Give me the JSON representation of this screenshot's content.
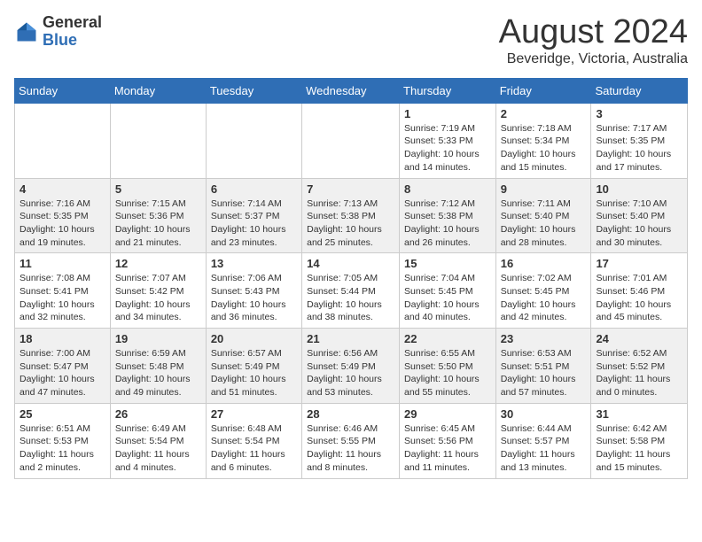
{
  "header": {
    "logo_general": "General",
    "logo_blue": "Blue",
    "month": "August 2024",
    "location": "Beveridge, Victoria, Australia"
  },
  "days_of_week": [
    "Sunday",
    "Monday",
    "Tuesday",
    "Wednesday",
    "Thursday",
    "Friday",
    "Saturday"
  ],
  "weeks": [
    [
      {
        "day": "",
        "text": ""
      },
      {
        "day": "",
        "text": ""
      },
      {
        "day": "",
        "text": ""
      },
      {
        "day": "",
        "text": ""
      },
      {
        "day": "1",
        "text": "Sunrise: 7:19 AM\nSunset: 5:33 PM\nDaylight: 10 hours and 14 minutes."
      },
      {
        "day": "2",
        "text": "Sunrise: 7:18 AM\nSunset: 5:34 PM\nDaylight: 10 hours and 15 minutes."
      },
      {
        "day": "3",
        "text": "Sunrise: 7:17 AM\nSunset: 5:35 PM\nDaylight: 10 hours and 17 minutes."
      }
    ],
    [
      {
        "day": "4",
        "text": "Sunrise: 7:16 AM\nSunset: 5:35 PM\nDaylight: 10 hours and 19 minutes."
      },
      {
        "day": "5",
        "text": "Sunrise: 7:15 AM\nSunset: 5:36 PM\nDaylight: 10 hours and 21 minutes."
      },
      {
        "day": "6",
        "text": "Sunrise: 7:14 AM\nSunset: 5:37 PM\nDaylight: 10 hours and 23 minutes."
      },
      {
        "day": "7",
        "text": "Sunrise: 7:13 AM\nSunset: 5:38 PM\nDaylight: 10 hours and 25 minutes."
      },
      {
        "day": "8",
        "text": "Sunrise: 7:12 AM\nSunset: 5:38 PM\nDaylight: 10 hours and 26 minutes."
      },
      {
        "day": "9",
        "text": "Sunrise: 7:11 AM\nSunset: 5:40 PM\nDaylight: 10 hours and 28 minutes."
      },
      {
        "day": "10",
        "text": "Sunrise: 7:10 AM\nSunset: 5:40 PM\nDaylight: 10 hours and 30 minutes."
      }
    ],
    [
      {
        "day": "11",
        "text": "Sunrise: 7:08 AM\nSunset: 5:41 PM\nDaylight: 10 hours and 32 minutes."
      },
      {
        "day": "12",
        "text": "Sunrise: 7:07 AM\nSunset: 5:42 PM\nDaylight: 10 hours and 34 minutes."
      },
      {
        "day": "13",
        "text": "Sunrise: 7:06 AM\nSunset: 5:43 PM\nDaylight: 10 hours and 36 minutes."
      },
      {
        "day": "14",
        "text": "Sunrise: 7:05 AM\nSunset: 5:44 PM\nDaylight: 10 hours and 38 minutes."
      },
      {
        "day": "15",
        "text": "Sunrise: 7:04 AM\nSunset: 5:45 PM\nDaylight: 10 hours and 40 minutes."
      },
      {
        "day": "16",
        "text": "Sunrise: 7:02 AM\nSunset: 5:45 PM\nDaylight: 10 hours and 42 minutes."
      },
      {
        "day": "17",
        "text": "Sunrise: 7:01 AM\nSunset: 5:46 PM\nDaylight: 10 hours and 45 minutes."
      }
    ],
    [
      {
        "day": "18",
        "text": "Sunrise: 7:00 AM\nSunset: 5:47 PM\nDaylight: 10 hours and 47 minutes."
      },
      {
        "day": "19",
        "text": "Sunrise: 6:59 AM\nSunset: 5:48 PM\nDaylight: 10 hours and 49 minutes."
      },
      {
        "day": "20",
        "text": "Sunrise: 6:57 AM\nSunset: 5:49 PM\nDaylight: 10 hours and 51 minutes."
      },
      {
        "day": "21",
        "text": "Sunrise: 6:56 AM\nSunset: 5:49 PM\nDaylight: 10 hours and 53 minutes."
      },
      {
        "day": "22",
        "text": "Sunrise: 6:55 AM\nSunset: 5:50 PM\nDaylight: 10 hours and 55 minutes."
      },
      {
        "day": "23",
        "text": "Sunrise: 6:53 AM\nSunset: 5:51 PM\nDaylight: 10 hours and 57 minutes."
      },
      {
        "day": "24",
        "text": "Sunrise: 6:52 AM\nSunset: 5:52 PM\nDaylight: 11 hours and 0 minutes."
      }
    ],
    [
      {
        "day": "25",
        "text": "Sunrise: 6:51 AM\nSunset: 5:53 PM\nDaylight: 11 hours and 2 minutes."
      },
      {
        "day": "26",
        "text": "Sunrise: 6:49 AM\nSunset: 5:54 PM\nDaylight: 11 hours and 4 minutes."
      },
      {
        "day": "27",
        "text": "Sunrise: 6:48 AM\nSunset: 5:54 PM\nDaylight: 11 hours and 6 minutes."
      },
      {
        "day": "28",
        "text": "Sunrise: 6:46 AM\nSunset: 5:55 PM\nDaylight: 11 hours and 8 minutes."
      },
      {
        "day": "29",
        "text": "Sunrise: 6:45 AM\nSunset: 5:56 PM\nDaylight: 11 hours and 11 minutes."
      },
      {
        "day": "30",
        "text": "Sunrise: 6:44 AM\nSunset: 5:57 PM\nDaylight: 11 hours and 13 minutes."
      },
      {
        "day": "31",
        "text": "Sunrise: 6:42 AM\nSunset: 5:58 PM\nDaylight: 11 hours and 15 minutes."
      }
    ]
  ]
}
